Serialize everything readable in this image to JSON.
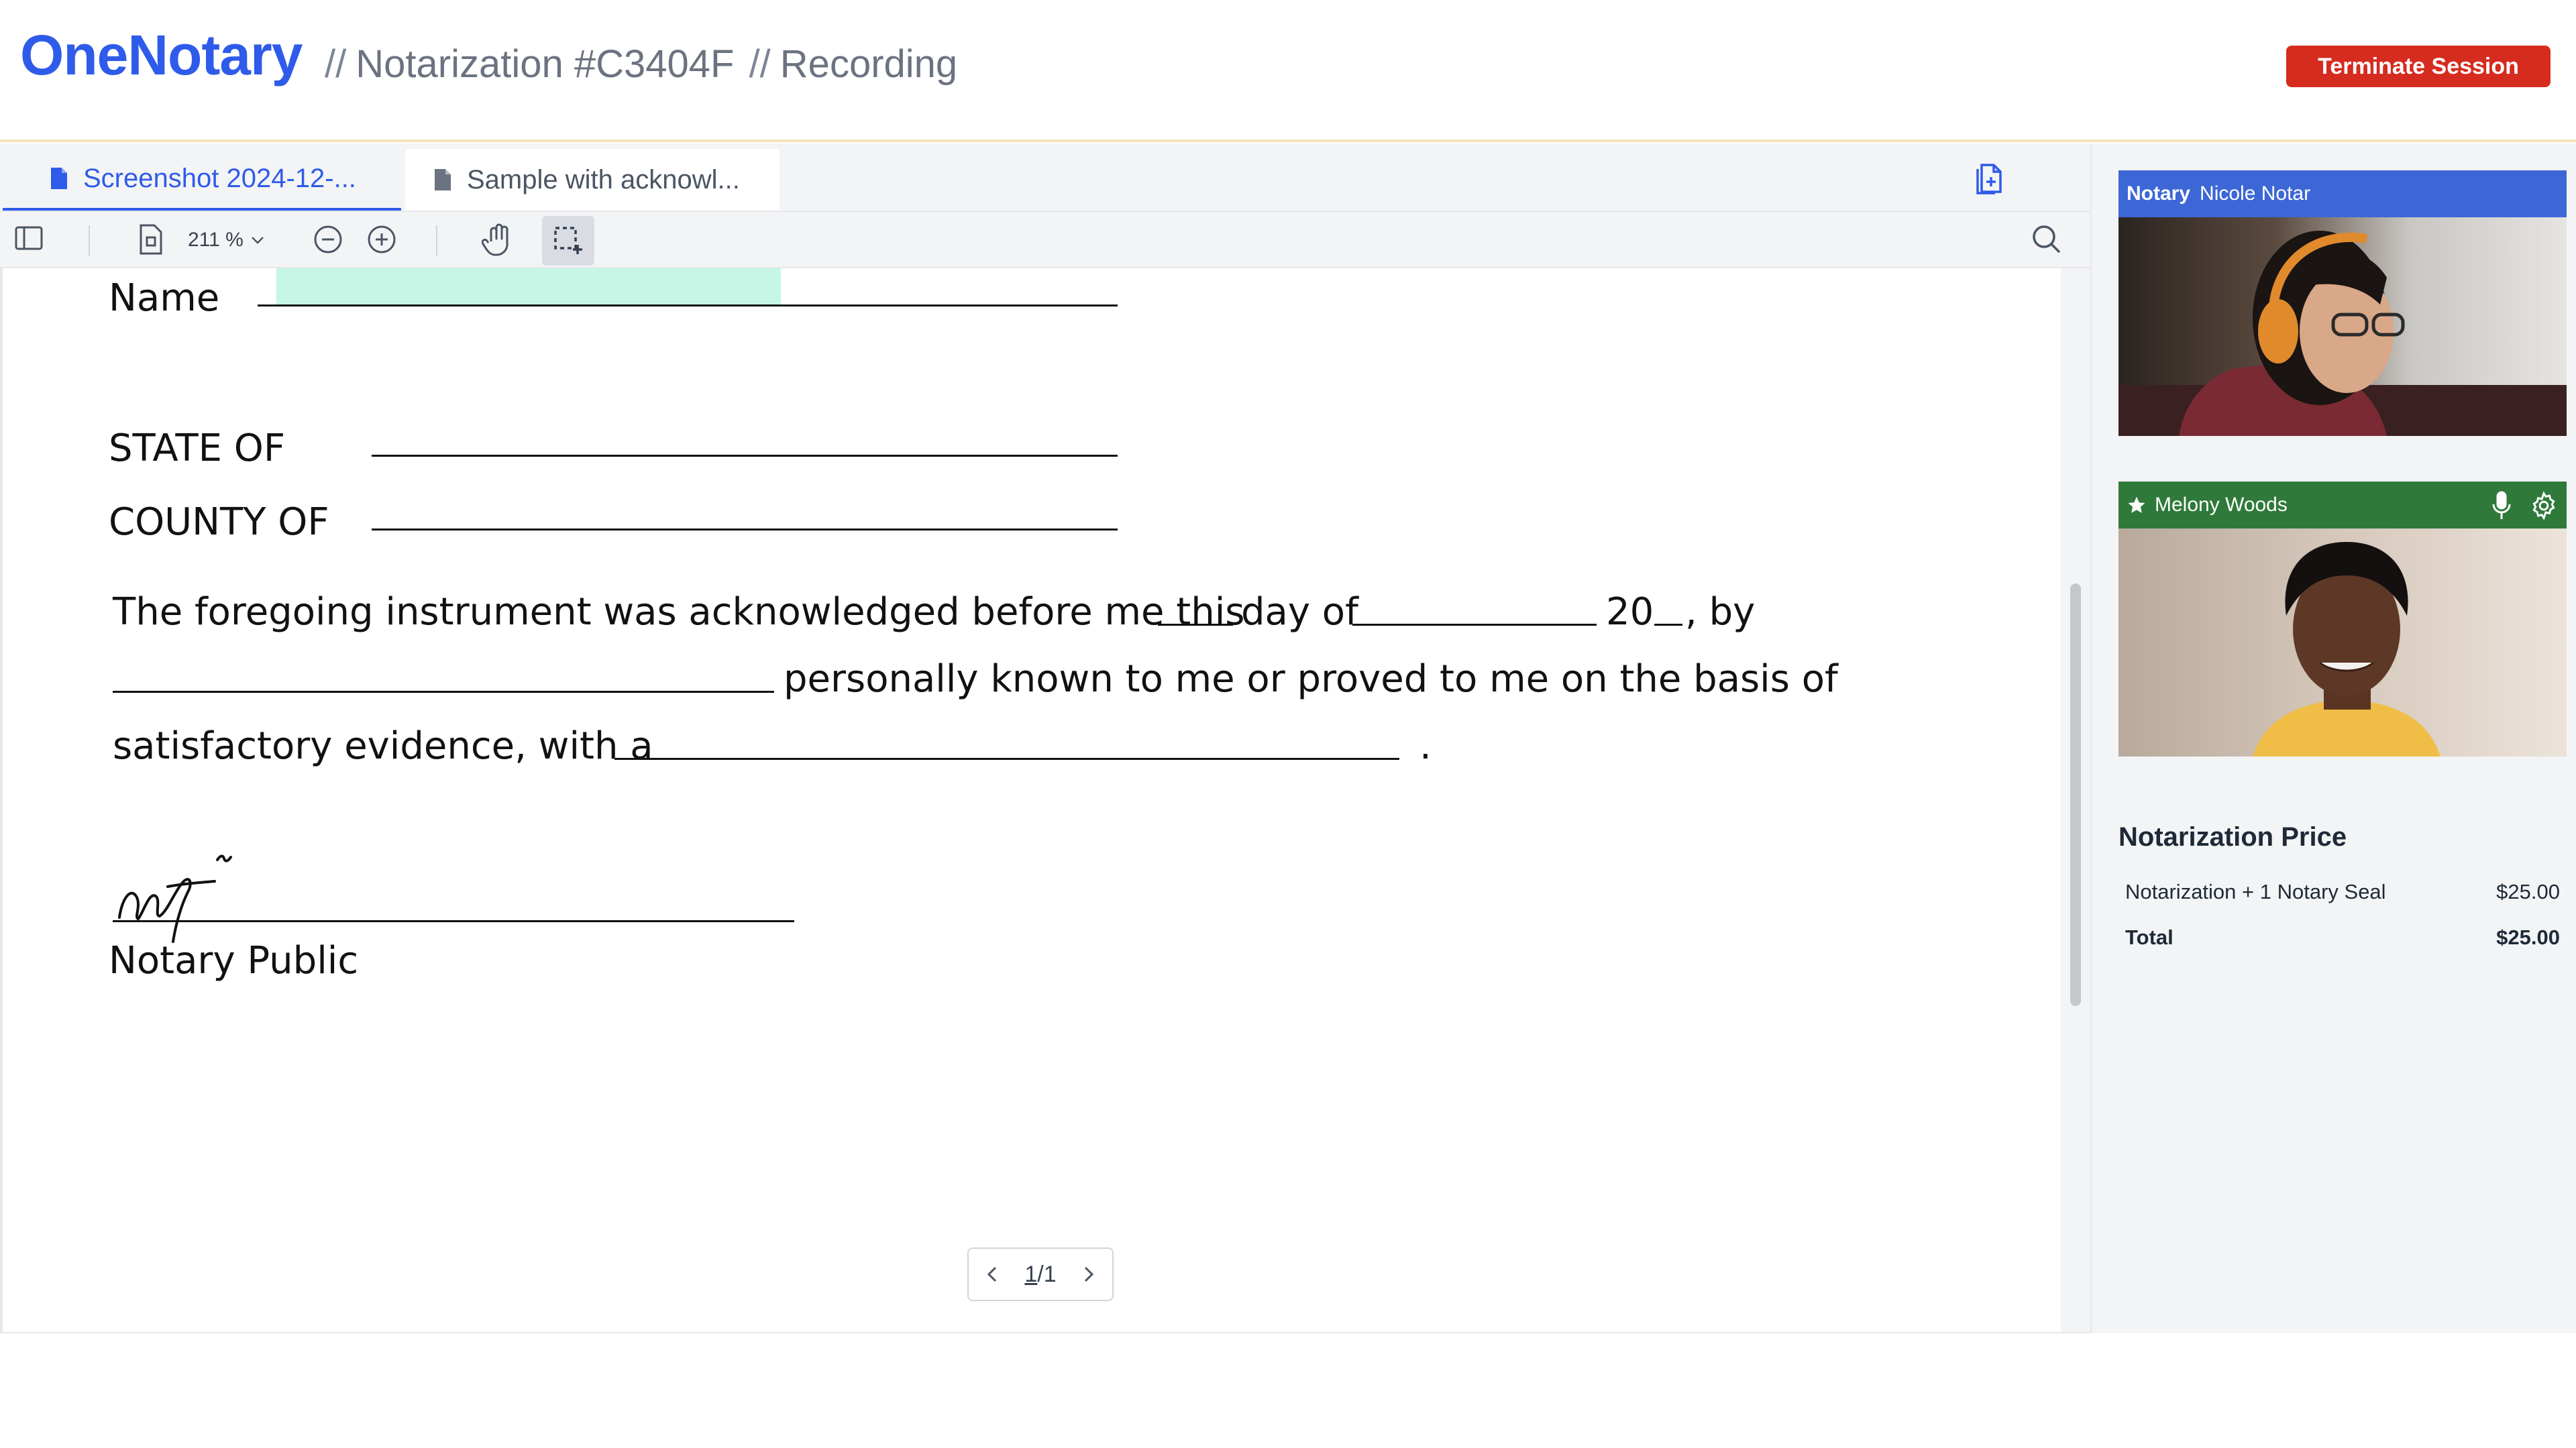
{
  "header": {
    "brand": "OneNotary",
    "separator": "//",
    "crumb_notarization": "Notarization #C3404F",
    "crumb_recording": "Recording",
    "terminate_label": "Terminate Session"
  },
  "tabs": [
    {
      "label": "Screenshot 2024-12-...",
      "active": true
    },
    {
      "label": "Sample with acknowl...",
      "active": false
    }
  ],
  "toolbar": {
    "zoom": "211 %"
  },
  "document": {
    "name_label": "Name",
    "state_label": "STATE OF",
    "county_label": "COUNTY OF",
    "line1_a": "The foregoing instrument was acknowledged before me this",
    "line1_b": "day of",
    "line1_c": "20",
    "line1_d": ", by",
    "line2": "personally known to me or proved to me on the basis of",
    "line3": "satisfactory evidence, with a",
    "line3_end": ".",
    "notary_public": "Notary Public"
  },
  "pager": {
    "current": "1",
    "sep": "/",
    "total": "1"
  },
  "participants": [
    {
      "role": "Notary",
      "name": "Nicole Notar"
    },
    {
      "role": "",
      "name": "Melony Woods"
    }
  ],
  "price": {
    "title": "Notarization Price",
    "rows": [
      {
        "label": "Notarization + 1 Notary Seal",
        "amount": "$25.00"
      },
      {
        "label": "Total",
        "amount": "$25.00"
      }
    ]
  },
  "colors": {
    "brand": "#2f5bea",
    "terminate": "#d62b1f",
    "notary_header": "#3d67d6",
    "signer_header": "#2f7a3a",
    "highlight": "#c6f6e6"
  },
  "icons": [
    "document-icon",
    "add-document-icon",
    "sidebar-toggle-icon",
    "page-fit-icon",
    "zoom-out-icon",
    "zoom-in-icon",
    "hand-tool-icon",
    "select-area-icon",
    "search-icon",
    "star-icon",
    "microphone-icon",
    "gear-icon",
    "chevron-left-icon",
    "chevron-right-icon"
  ]
}
